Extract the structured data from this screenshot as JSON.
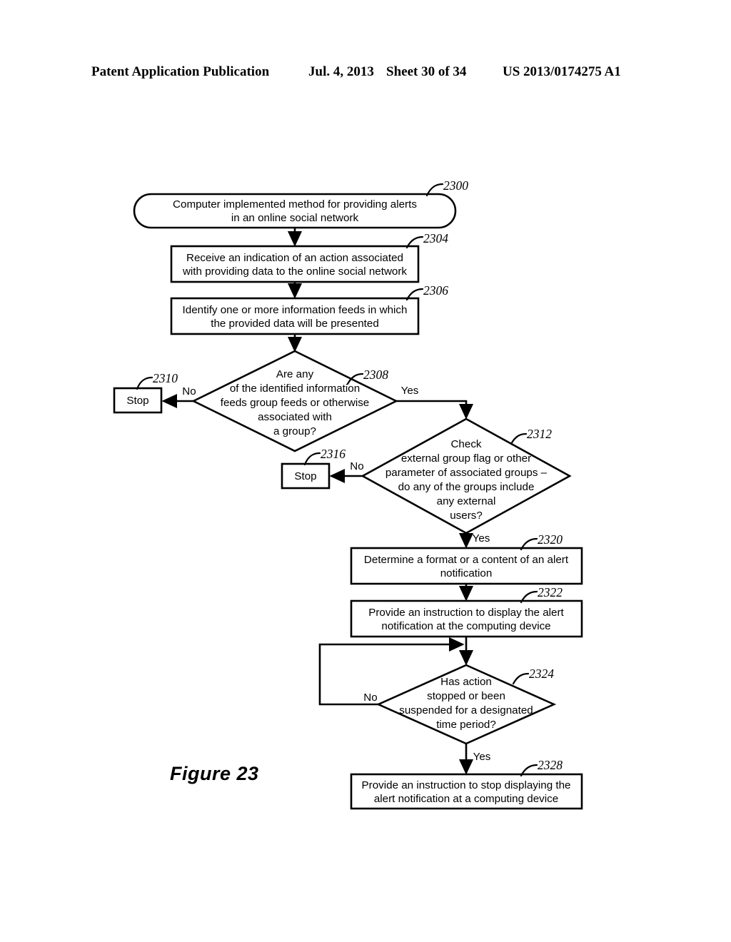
{
  "header": {
    "publication": "Patent Application Publication",
    "date": "Jul. 4, 2013",
    "sheet": "Sheet 30 of 34",
    "patent_number": "US 2013/0174275 A1"
  },
  "figure": {
    "caption": "Figure 23"
  },
  "flowchart": {
    "nodes": [
      {
        "id": "2300",
        "ref": "2300",
        "shape": "terminator",
        "lines": [
          "Computer implemented method for providing alerts",
          "in an online social network"
        ]
      },
      {
        "id": "2304",
        "ref": "2304",
        "shape": "process",
        "lines": [
          "Receive an indication of an action associated",
          "with providing data to the online social network"
        ]
      },
      {
        "id": "2306",
        "ref": "2306",
        "shape": "process",
        "lines": [
          "Identify one or more information feeds in which",
          "the provided data will be presented"
        ]
      },
      {
        "id": "2308",
        "ref": "2308",
        "shape": "decision",
        "lines": [
          "Are any",
          "of the identified information",
          "feeds group feeds or otherwise",
          "associated with",
          "a group?"
        ]
      },
      {
        "id": "2310",
        "ref": "2310",
        "shape": "process",
        "lines": [
          "Stop"
        ]
      },
      {
        "id": "2312",
        "ref": "2312",
        "shape": "decision",
        "lines": [
          "Check",
          "external group flag or other",
          "parameter of associated groups –",
          "do any of the groups include",
          "any external",
          "users?"
        ]
      },
      {
        "id": "2316",
        "ref": "2316",
        "shape": "process",
        "lines": [
          "Stop"
        ]
      },
      {
        "id": "2320",
        "ref": "2320",
        "shape": "process",
        "lines": [
          "Determine a format or a content of an alert",
          "notification"
        ]
      },
      {
        "id": "2322",
        "ref": "2322",
        "shape": "process",
        "lines": [
          "Provide an instruction to display the alert",
          "notification at the computing device"
        ]
      },
      {
        "id": "2324",
        "ref": "2324",
        "shape": "decision",
        "lines": [
          "Has action",
          "stopped or been",
          "suspended for a designated",
          "time period?"
        ]
      },
      {
        "id": "2328",
        "ref": "2328",
        "shape": "process",
        "lines": [
          "Provide an instruction to stop displaying the",
          "alert notification at a computing device"
        ]
      }
    ],
    "edge_labels": {
      "d2308_no": "No",
      "d2308_yes": "Yes",
      "d2312_no": "No",
      "d2312_yes": "Yes",
      "d2324_no": "No",
      "d2324_yes": "Yes"
    }
  },
  "colors": {
    "ink": "#000000",
    "paper": "#ffffff"
  }
}
